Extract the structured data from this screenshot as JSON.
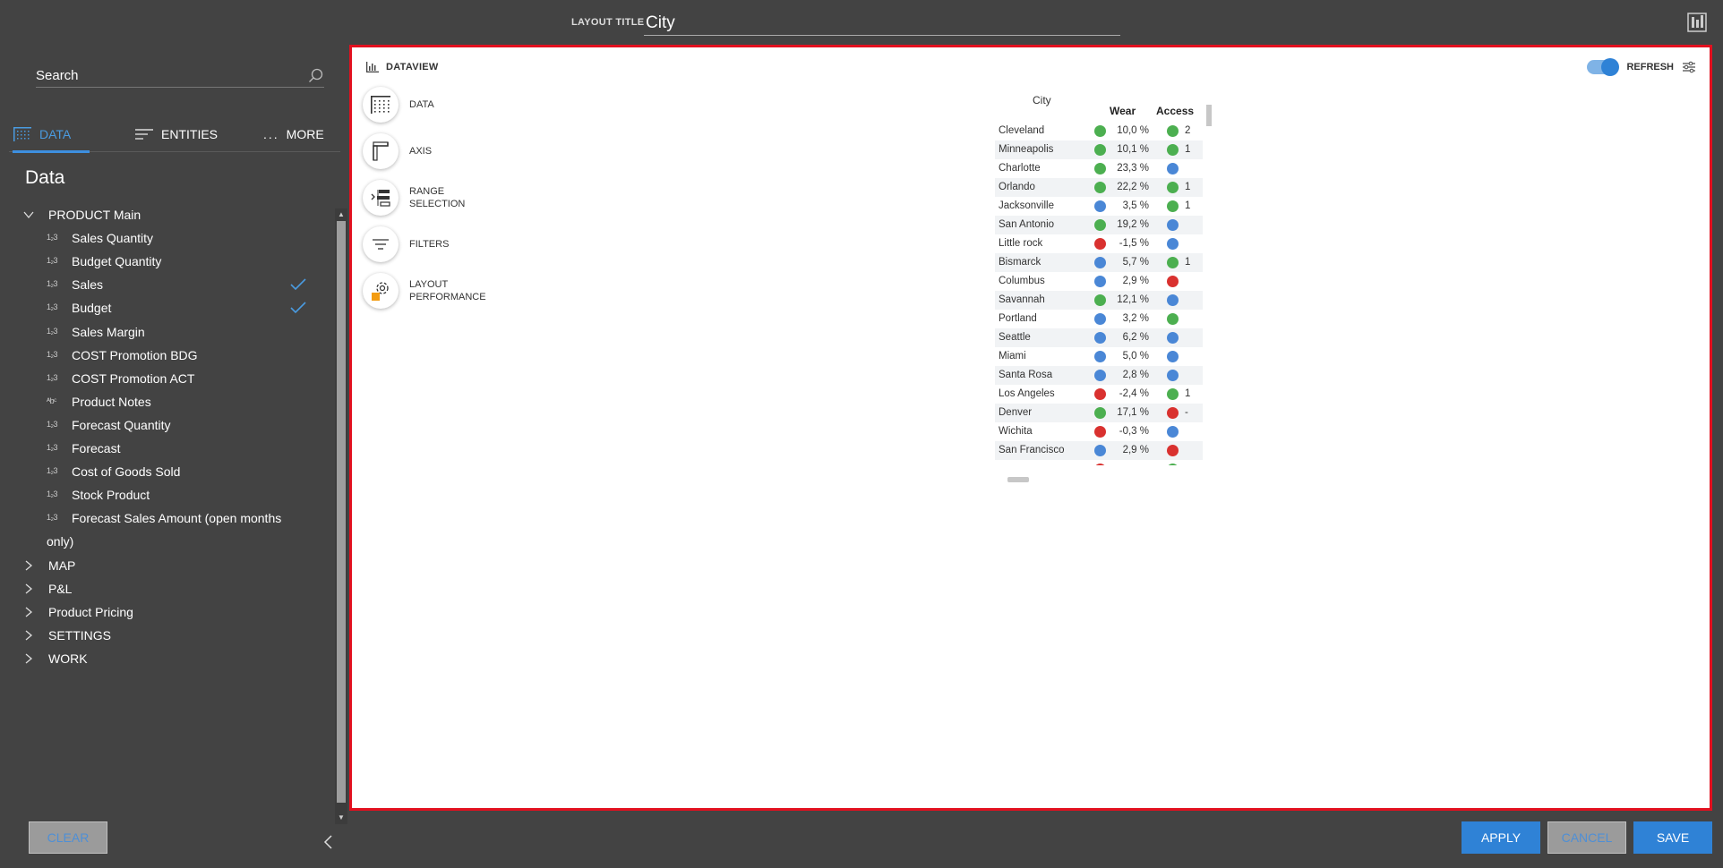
{
  "header": {
    "layout_title_label": "LAYOUT TITLE",
    "layout_title_value": "City"
  },
  "sidebar": {
    "search_placeholder": "Search",
    "tabs": [
      {
        "label": "DATA",
        "icon": "data-grid-icon",
        "active": true
      },
      {
        "label": "ENTITIES",
        "icon": "list-icon",
        "active": false
      },
      {
        "label": "MORE",
        "icon": "ellipsis-icon",
        "active": false
      }
    ],
    "section_title": "Data",
    "tree": {
      "group": "PRODUCT Main",
      "items": [
        {
          "type": "num",
          "label": "Sales Quantity",
          "checked": false
        },
        {
          "type": "num",
          "label": "Budget Quantity",
          "checked": false
        },
        {
          "type": "num",
          "label": "Sales",
          "checked": true
        },
        {
          "type": "num",
          "label": "Budget",
          "checked": true
        },
        {
          "type": "num",
          "label": "Sales Margin",
          "checked": false
        },
        {
          "type": "num",
          "label": "COST Promotion BDG",
          "checked": false
        },
        {
          "type": "num",
          "label": "COST Promotion ACT",
          "checked": false
        },
        {
          "type": "text",
          "label": "Product Notes",
          "checked": false
        },
        {
          "type": "num",
          "label": "Forecast Quantity",
          "checked": false
        },
        {
          "type": "num",
          "label": "Forecast",
          "checked": false
        },
        {
          "type": "num",
          "label": "Cost of Goods Sold",
          "checked": false
        },
        {
          "type": "num",
          "label": "Stock Product",
          "checked": false
        },
        {
          "type": "num",
          "label": "Forecast Sales Amount (open months",
          "checked": false
        }
      ],
      "wrap_line": "only)",
      "collapsed_groups": [
        "MAP",
        "P&L",
        "Product Pricing",
        "SETTINGS",
        "WORK"
      ]
    },
    "type_glyphs": {
      "num": "1₂3",
      "text": "ᴬbᶜ"
    }
  },
  "canvas": {
    "title": "DATAVIEW",
    "refresh_label": "REFRESH",
    "menu": [
      {
        "label1": "DATA",
        "label2": "",
        "icon": "data-grid-icon"
      },
      {
        "label1": "AXIS",
        "label2": "",
        "icon": "axis-icon"
      },
      {
        "label1": "RANGE",
        "label2": "SELECTION",
        "icon": "range-selection-icon"
      },
      {
        "label1": "FILTERS",
        "label2": "",
        "icon": "filter-icon"
      },
      {
        "label1": "LAYOUT",
        "label2": "PERFORMANCE",
        "icon": "layout-performance-icon"
      }
    ]
  },
  "grid": {
    "header_city": "City",
    "header_wear": "Wear",
    "header_access": "Access",
    "rows": [
      {
        "city": "Cleveland",
        "wear_status": "green",
        "wear": "10,0 %",
        "acc_status": "green",
        "acc": "2"
      },
      {
        "city": "Minneapolis",
        "wear_status": "green",
        "wear": "10,1 %",
        "acc_status": "green",
        "acc": "1"
      },
      {
        "city": "Charlotte",
        "wear_status": "green",
        "wear": "23,3 %",
        "acc_status": "blue",
        "acc": ""
      },
      {
        "city": "Orlando",
        "wear_status": "green",
        "wear": "22,2 %",
        "acc_status": "green",
        "acc": "1"
      },
      {
        "city": "Jacksonville",
        "wear_status": "blue",
        "wear": "3,5 %",
        "acc_status": "green",
        "acc": "1"
      },
      {
        "city": "San Antonio",
        "wear_status": "green",
        "wear": "19,2 %",
        "acc_status": "blue",
        "acc": ""
      },
      {
        "city": "Little rock",
        "wear_status": "red",
        "wear": "-1,5 %",
        "acc_status": "blue",
        "acc": ""
      },
      {
        "city": "Bismarck",
        "wear_status": "blue",
        "wear": "5,7 %",
        "acc_status": "green",
        "acc": "1"
      },
      {
        "city": "Columbus",
        "wear_status": "blue",
        "wear": "2,9 %",
        "acc_status": "red",
        "acc": ""
      },
      {
        "city": "Savannah",
        "wear_status": "green",
        "wear": "12,1 %",
        "acc_status": "blue",
        "acc": ""
      },
      {
        "city": "Portland",
        "wear_status": "blue",
        "wear": "3,2 %",
        "acc_status": "green",
        "acc": ""
      },
      {
        "city": "Seattle",
        "wear_status": "blue",
        "wear": "6,2 %",
        "acc_status": "blue",
        "acc": ""
      },
      {
        "city": "Miami",
        "wear_status": "blue",
        "wear": "5,0 %",
        "acc_status": "blue",
        "acc": ""
      },
      {
        "city": "Santa Rosa",
        "wear_status": "blue",
        "wear": "2,8 %",
        "acc_status": "blue",
        "acc": ""
      },
      {
        "city": "Los Angeles",
        "wear_status": "red",
        "wear": "-2,4 %",
        "acc_status": "green",
        "acc": "1"
      },
      {
        "city": "Denver",
        "wear_status": "green",
        "wear": "17,1 %",
        "acc_status": "red",
        "acc": "-"
      },
      {
        "city": "Wichita",
        "wear_status": "red",
        "wear": "-0,3 %",
        "acc_status": "blue",
        "acc": ""
      },
      {
        "city": "San Francisco",
        "wear_status": "blue",
        "wear": "2,9 %",
        "acc_status": "red",
        "acc": ""
      }
    ]
  },
  "status_colors": {
    "green": "#4caf50",
    "blue": "#4a87d6",
    "red": "#d9312f"
  },
  "buttons": {
    "clear": "CLEAR",
    "apply": "APPLY",
    "cancel": "CANCEL",
    "save": "SAVE"
  },
  "colors": {
    "accent": "#2f82d6",
    "frame": "#e2101f",
    "background": "#434343"
  }
}
